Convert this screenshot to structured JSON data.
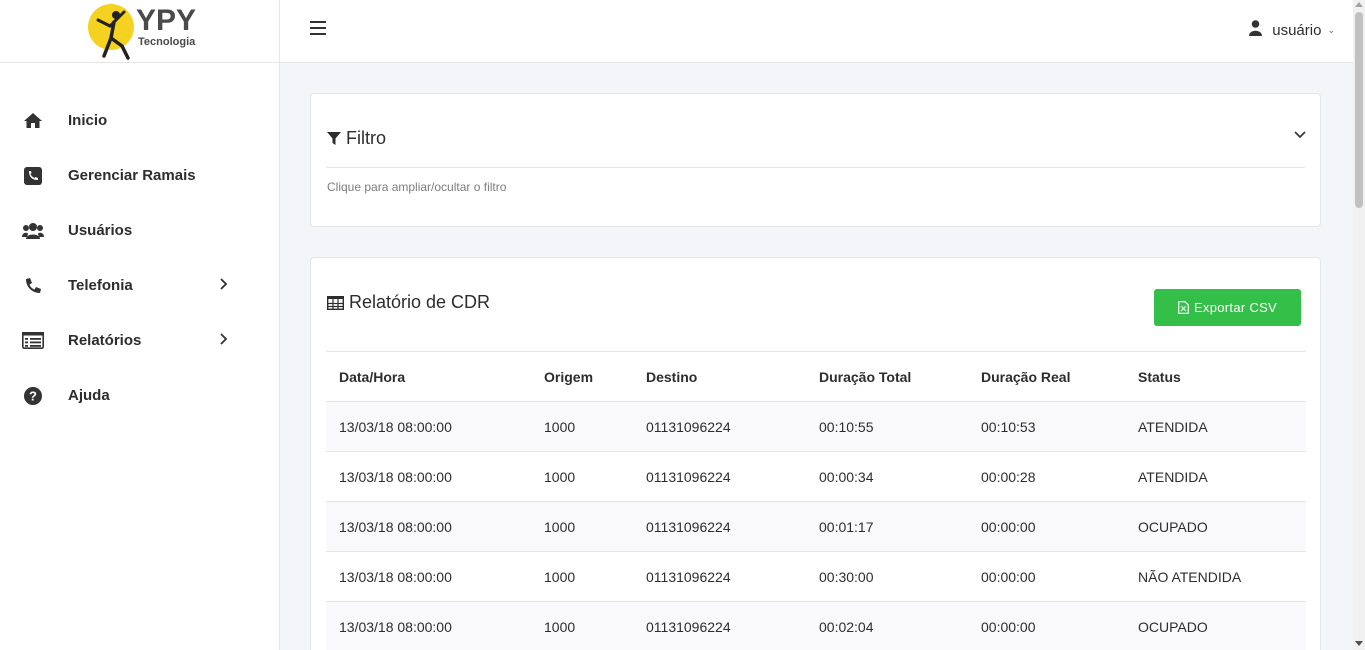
{
  "brand": {
    "name": "YPY",
    "subtitle": "Tecnologia"
  },
  "sidebar": {
    "items": [
      {
        "label": "Inicio",
        "icon": "home-icon",
        "has_submenu": false
      },
      {
        "label": "Gerenciar Ramais",
        "icon": "phone-square-icon",
        "has_submenu": false
      },
      {
        "label": "Usuários",
        "icon": "users-icon",
        "has_submenu": false
      },
      {
        "label": "Telefonia",
        "icon": "phone-icon",
        "has_submenu": true
      },
      {
        "label": "Relatórios",
        "icon": "list-alt-icon",
        "has_submenu": true
      },
      {
        "label": "Ajuda",
        "icon": "question-circle-icon",
        "has_submenu": false
      }
    ]
  },
  "topbar": {
    "user_name": "usuário",
    "caret": "⌄"
  },
  "filter": {
    "title": "Filtro",
    "hint": "Clique para ampliar/ocultar o filtro"
  },
  "report": {
    "title": "Relatório de CDR",
    "export_label": "Exportar CSV",
    "columns": [
      "Data/Hora",
      "Origem",
      "Destino",
      "Duração Total",
      "Duração Real",
      "Status"
    ],
    "rows": [
      [
        "13/03/18 08:00:00",
        "1000",
        "01131096224",
        "00:10:55",
        "00:10:53",
        "ATENDIDA"
      ],
      [
        "13/03/18 08:00:00",
        "1000",
        "01131096224",
        "00:00:34",
        "00:00:28",
        "ATENDIDA"
      ],
      [
        "13/03/18 08:00:00",
        "1000",
        "01131096224",
        "00:01:17",
        "00:00:00",
        "OCUPADO"
      ],
      [
        "13/03/18 08:00:00",
        "1000",
        "01131096224",
        "00:30:00",
        "00:00:00",
        "NÃO ATENDIDA"
      ],
      [
        "13/03/18 08:00:00",
        "1000",
        "01131096224",
        "00:02:04",
        "00:00:00",
        "OCUPADO"
      ]
    ]
  },
  "colors": {
    "accent_green": "#34bf49",
    "logo_yellow": "#f4d21f"
  }
}
